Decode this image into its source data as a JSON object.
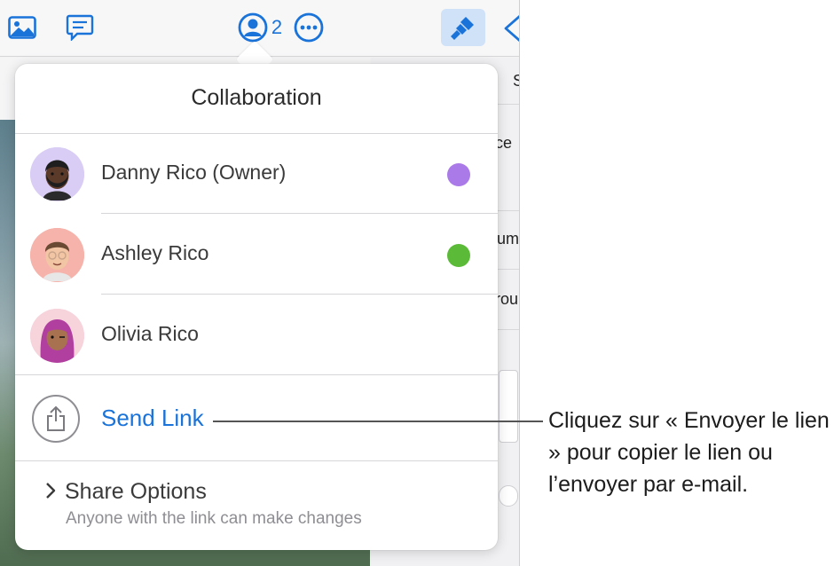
{
  "toolbar": {
    "icons": {
      "photo": "photo-icon",
      "comment": "comment-icon",
      "collaboration": "person-circle-icon",
      "more": "ellipsis-circle-icon",
      "format": "paintbrush-icon",
      "back": "chevron-left-icon"
    },
    "collaborator_count": "2",
    "accent_color": "#1a73d9",
    "format_active_bg": "#cfe2f8"
  },
  "side_panel": {
    "partial_texts": [
      "S",
      "ce",
      "um",
      "rou"
    ]
  },
  "popover": {
    "title": "Collaboration",
    "participants": [
      {
        "name": "Danny Rico (Owner)",
        "presence_color": "#a97ae8",
        "avatar": "memoji-avatar-icon"
      },
      {
        "name": "Ashley Rico",
        "presence_color": "#5bbb38",
        "avatar": "memoji-avatar-icon"
      },
      {
        "name": "Olivia Rico",
        "presence_color": null,
        "avatar": "memoji-avatar-icon"
      }
    ],
    "send_link": {
      "label": "Send Link",
      "icon": "share-icon"
    },
    "share_options": {
      "label": "Share Options",
      "subtitle": "Anyone with the link can make changes",
      "icon": "chevron-right-icon"
    }
  },
  "callout": {
    "text": "Cliquez sur « Envoyer le lien » pour copier le lien ou l’envoyer par e-mail."
  }
}
